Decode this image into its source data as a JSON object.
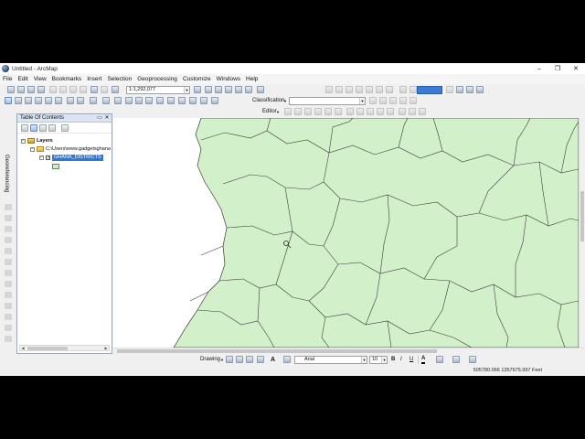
{
  "window": {
    "title": "Untitled - ArcMap",
    "controls": [
      "–",
      "❐",
      "✕"
    ]
  },
  "menu": [
    "File",
    "Edit",
    "View",
    "Bookmarks",
    "Insert",
    "Selection",
    "Geoprocessing",
    "Customize",
    "Windows",
    "Help"
  ],
  "toolbar": {
    "scale_value": "1:1,292,077",
    "classification_label": "Classification",
    "editor_label": "Editor"
  },
  "georeferencing": {
    "label": "Georeferencing"
  },
  "toc": {
    "title": "Table Of Contents",
    "root_label": "Layers",
    "folder_label": "C:\\Users\\www.gadgetsghana",
    "layer_name": "GHANA_DISTRICTS"
  },
  "drawing": {
    "label": "Drawing",
    "font_name": "Arial",
    "font_size": "10",
    "bold": "B",
    "italic": "I",
    "underline": "U",
    "text_tool": "A"
  },
  "status": {
    "coordinates": "505780.066  1357675.997 Feet"
  },
  "colors": {
    "map_fill": "#d2f0c9",
    "boundary": "#3c3c3c",
    "selection": "#3178d0"
  }
}
